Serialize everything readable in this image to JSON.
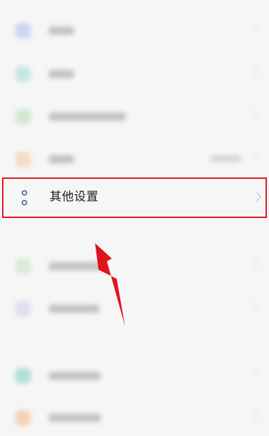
{
  "settings_list": {
    "focused_item": {
      "label": "其他设置",
      "icon": "dots-vertical-icon"
    },
    "blurred_items": [
      {
        "icon": "blue-square-icon",
        "color": "#c9d2f2"
      },
      {
        "icon": "teal-square-icon",
        "color": "#bfe7df"
      },
      {
        "icon": "green-square-icon",
        "color": "#cfe7cf"
      },
      {
        "icon": "orange-square-icon",
        "color": "#f6d9bf"
      },
      {
        "icon": "green-square-icon",
        "color": "#d6ead6"
      },
      {
        "icon": "lavender-square-icon",
        "color": "#dcdcf0"
      },
      {
        "icon": "teal-square-icon",
        "color": "#a9ded2"
      },
      {
        "icon": "orange-square-icon",
        "color": "#f4cfae"
      }
    ]
  },
  "annotation": {
    "highlight_color": "#e0141e",
    "arrow_color": "#e0141e"
  }
}
